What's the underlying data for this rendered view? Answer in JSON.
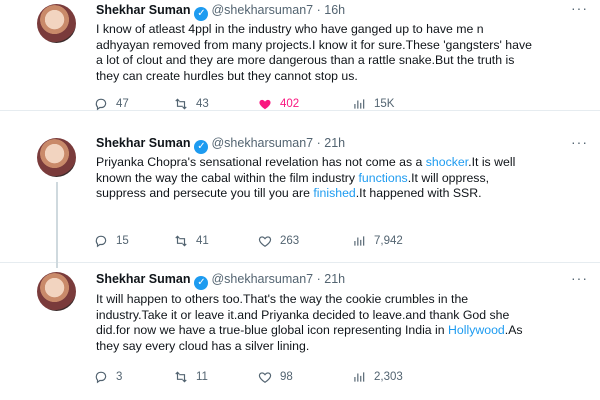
{
  "tweets": [
    {
      "name": "Shekhar Suman",
      "handle": "@shekharsuman7",
      "dot": "·",
      "time": "16h",
      "body": [
        {
          "t": "I know of atleast 4ppl in the industry who have ganged up to have me n adhyayan removed from many projects.I know it for sure.These 'gangsters' have a lot of clout and they are more dangerous than a rattle snake.But the truth is they can create hurdles but they cannot stop us.",
          "link": false
        }
      ],
      "stats": {
        "replies": "47",
        "retweets": "43",
        "likes": "402",
        "views": "15K"
      }
    },
    {
      "name": "Shekhar Suman",
      "handle": "@shekharsuman7",
      "dot": "·",
      "time": "21h",
      "body": [
        {
          "t": "Priyanka Chopra's sensational revelation has not come as a ",
          "link": false
        },
        {
          "t": "shocker",
          "link": true
        },
        {
          "t": ".It is well known the way the cabal within the film industry ",
          "link": false
        },
        {
          "t": "functions",
          "link": true
        },
        {
          "t": ".It will oppress, suppress and persecute you till you are ",
          "link": false
        },
        {
          "t": "finished",
          "link": true
        },
        {
          "t": ".It happened with SSR.",
          "link": false
        }
      ],
      "stats": {
        "replies": "15",
        "retweets": "41",
        "likes": "263",
        "views": "7,942"
      }
    },
    {
      "name": "Shekhar Suman",
      "handle": "@shekharsuman7",
      "dot": "·",
      "time": "21h",
      "body": [
        {
          "t": "It will happen to others too.That's the way the cookie crumbles in the industry.Take it or leave it.and Priyanka decided to leave.and thank God she did.for now we have a true-blue global icon representing India in ",
          "link": false
        },
        {
          "t": "Hollywood",
          "link": true
        },
        {
          "t": ".As they say every cloud has a silver lining.",
          "link": false
        }
      ],
      "stats": {
        "replies": "3",
        "retweets": "11",
        "likes": "98",
        "views": "2,303"
      }
    }
  ],
  "icons": {
    "verified": "verified-badge-icon",
    "more": "more-options-icon",
    "reply": "reply-icon",
    "retweet": "retweet-icon",
    "like": "like-icon",
    "views": "views-icon"
  },
  "colors": {
    "link": "#1d9bf0",
    "like_active": "#f91880",
    "muted": "#536471"
  }
}
